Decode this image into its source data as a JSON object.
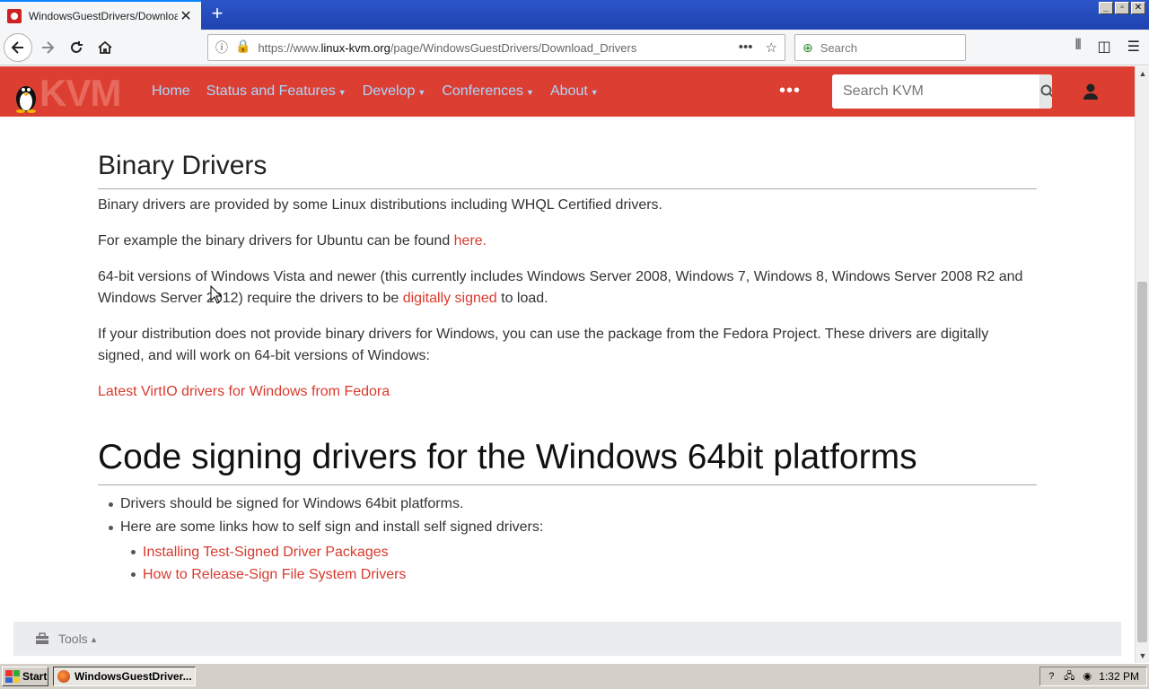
{
  "browser": {
    "tab_title": "WindowsGuestDrivers/Download_D",
    "tab_close": "✕",
    "newtab": "+",
    "url_prefix": "https://www.",
    "url_domain": "linux-kvm.org",
    "url_path": "/page/WindowsGuestDrivers/Download_Drivers",
    "search_placeholder": "Search",
    "window_controls": [
      "_",
      "▫",
      "✕"
    ]
  },
  "site": {
    "logo_text": "KVM",
    "menu": [
      {
        "label": "Home",
        "dropdown": false
      },
      {
        "label": "Status and Features",
        "dropdown": true
      },
      {
        "label": "Develop",
        "dropdown": true
      },
      {
        "label": "Conferences",
        "dropdown": true
      },
      {
        "label": "About",
        "dropdown": true
      }
    ],
    "more": "•••",
    "search_placeholder": "Search KVM"
  },
  "content": {
    "binary_heading": "Binary Drivers",
    "p1": "Binary drivers are provided by some Linux distributions including WHQL Certified drivers.",
    "p2_text": "For example the binary drivers for Ubuntu can be found ",
    "p2_link": "here.",
    "p3_text_a": "64-bit versions of Windows Vista and newer (this currently includes Windows Server 2008, Windows 7, Windows 8, Windows Server 2008 R2 and Windows Server 2012) require the drivers to be ",
    "p3_link": "digitally signed",
    "p3_text_b": " to load.",
    "p4": "If your distribution does not provide binary drivers for Windows, you can use the package from the Fedora Project. These drivers are digitally signed, and will work on 64-bit versions of Windows:",
    "fedora_link": "Latest VirtIO drivers for Windows from Fedora",
    "code_heading": "Code signing drivers for the Windows 64bit platforms",
    "bullets": [
      "Drivers should be signed for Windows 64bit platforms.",
      "Here are some links how to self sign and install self signed drivers:"
    ],
    "sub_links": [
      "Installing Test-Signed Driver Packages",
      "How to Release-Sign File System Drivers"
    ]
  },
  "footer": {
    "tools_label": "Tools",
    "tools_caret": "▴"
  },
  "taskbar": {
    "start_label": "Start",
    "task_label": "WindowsGuestDriver...",
    "clock": "1:32 PM"
  },
  "colors": {
    "header_bg": "#dc3f32",
    "menu_link": "#a8d7ff",
    "content_link": "#d83a2e"
  }
}
